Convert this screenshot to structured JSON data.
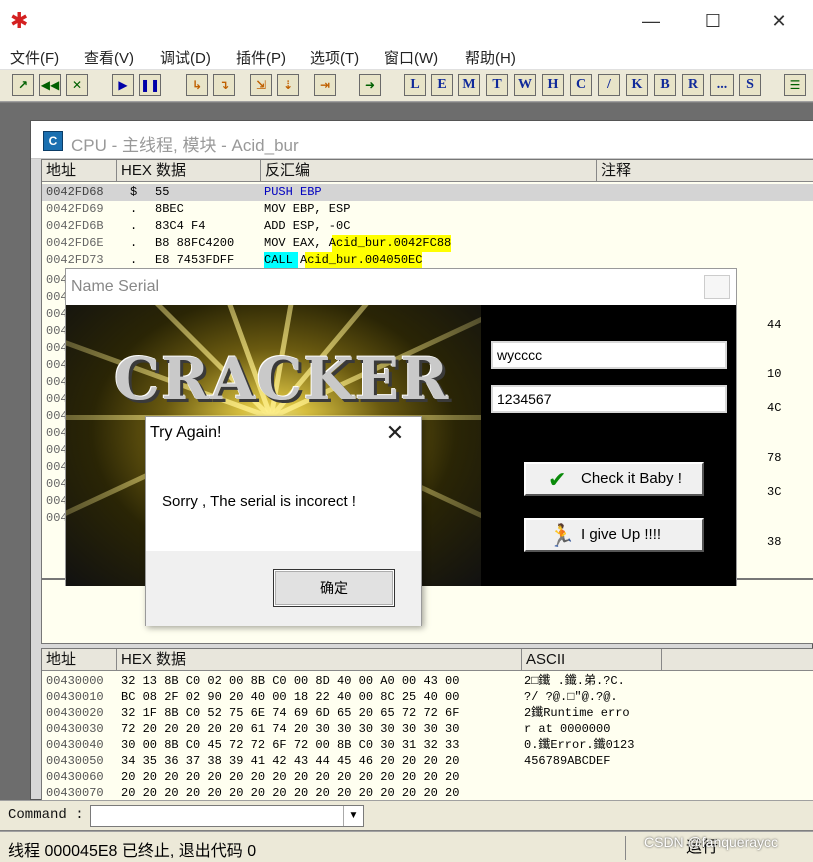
{
  "window": {
    "min": "—",
    "max": "☐",
    "close": "✕",
    "app_icon": "bug-icon"
  },
  "menu": [
    "文件(F)",
    "查看(V)",
    "调试(D)",
    "插件(P)",
    "选项(T)",
    "窗口(W)",
    "帮助(H)"
  ],
  "toolbar": {
    "letters": [
      "L",
      "E",
      "M",
      "T",
      "W",
      "H",
      "C",
      "/",
      "K",
      "B",
      "R",
      "...",
      "S"
    ]
  },
  "cpu": {
    "title": "CPU - 主线程, 模块 - Acid_bur",
    "icon_letter": "C",
    "headers": {
      "addr": "地址",
      "hex": "HEX 数据",
      "disasm": "反汇编",
      "comment": "注释"
    },
    "rows": [
      {
        "addr": "0042FD68",
        "mark": "$",
        "hex": "55",
        "asm": "PUSH EBP"
      },
      {
        "addr": "0042FD69",
        "mark": ".",
        "hex": "8BEC",
        "asm": "MOV EBP, ESP"
      },
      {
        "addr": "0042FD6B",
        "mark": ".",
        "hex": "83C4 F4",
        "asm": "ADD ESP, -0C"
      },
      {
        "addr": "0042FD6E",
        "mark": ".",
        "hex": "B8 88FC4200",
        "asm": "MOV EAX, Acid_bur.0042FC88"
      },
      {
        "addr": "0042FD73",
        "mark": ".",
        "hex": "E8 7453FDFF",
        "asm": "CALL Acid_bur.004050EC"
      }
    ],
    "left_prefix": "004",
    "right_glimpse": [
      "44",
      "10",
      "4C",
      "78",
      "3C",
      "38"
    ]
  },
  "dump": {
    "headers": {
      "addr": "地址",
      "hex": "HEX 数据",
      "ascii": "ASCII"
    },
    "rows": [
      {
        "addr": "00430000",
        "hex": "32 13 8B C0 02 00 8B C0 00 8D 40 00 A0 00 43 00",
        "ascii": "2□鑯 .鑯.弟.?C."
      },
      {
        "addr": "00430010",
        "hex": "BC 08 2F 02 90 20 40 00 18 22 40 00 8C 25 40 00",
        "ascii": "?/ ?@.□\"@.?@."
      },
      {
        "addr": "00430020",
        "hex": "32 1F 8B C0 52 75 6E 74 69 6D 65 20 65 72 72 6F",
        "ascii": "2鑯Runtime erro"
      },
      {
        "addr": "00430030",
        "hex": "72 20 20 20 20 20 61 74 20 30 30 30 30 30 30 30",
        "ascii": "r     at 0000000"
      },
      {
        "addr": "00430040",
        "hex": "30 00 8B C0 45 72 72 6F 72 00 8B C0 30 31 32 33",
        "ascii": "0.鑯Error.鑯0123"
      },
      {
        "addr": "00430050",
        "hex": "34 35 36 37 38 39 41 42 43 44 45 46 20 20 20 20",
        "ascii": "456789ABCDEF"
      },
      {
        "addr": "00430060",
        "hex": "20 20 20 20 20 20 20 20 20 20 20 20 20 20 20 20",
        "ascii": ""
      },
      {
        "addr": "00430070",
        "hex": "20 20 20 20 20 20 20 20 20 20 20 20 20 20 20 20",
        "ascii": ""
      }
    ]
  },
  "name_serial": {
    "title": "Name Serial",
    "logo": "CRACKER",
    "name_value": "wycccc",
    "serial_value": "1234567",
    "check_btn": "Check it Baby !",
    "giveup_btn": "I give Up !!!!"
  },
  "try_again": {
    "title": "Try Again!",
    "message": "Sorry , The serial is incorect !",
    "ok": "确定",
    "close": "✕"
  },
  "command": {
    "label": "Command :"
  },
  "status": {
    "text": "线程 000045E8 已终止, 退出代码 0",
    "right": "运行"
  },
  "watermark": "CSDN @fanqueraycc"
}
